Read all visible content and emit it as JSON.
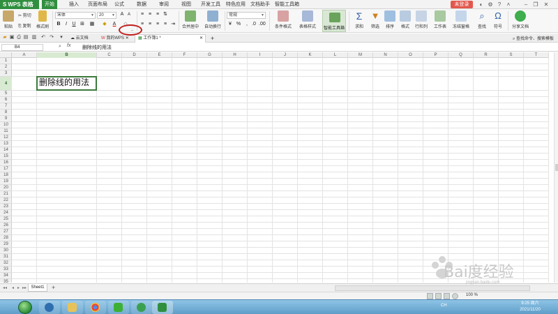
{
  "app": {
    "name": "WPS 表格"
  },
  "menu": {
    "tabs": [
      "开始",
      "插入",
      "页面布局",
      "公式",
      "数据",
      "审阅",
      "视图",
      "开发工具",
      "特色应用",
      "文档助手",
      "智能工具箱"
    ],
    "active": "开始",
    "login": "未登录"
  },
  "ribbon": {
    "paste": "粘贴",
    "cut": "剪切",
    "copy": "复制",
    "format_painter": "格式刷",
    "font_name": "宋体",
    "font_size": "20",
    "merge_center": "合并居中",
    "wrap_text": "自动换行",
    "number_format": "常规",
    "conditional_format": "条件格式",
    "table_style": "表格样式",
    "smart_toolbox": "智能工具箱",
    "sum": "求和",
    "filter": "筛选",
    "sort": "排序",
    "format": "格式",
    "rows_cols": "行和列",
    "worksheet": "工作表",
    "freeze": "冻结窗格",
    "find": "查找",
    "symbol": "符号",
    "share": "分享文档"
  },
  "doc_tabs": {
    "cloud": "云文档",
    "my_wps": "我的WPS",
    "workbook": "工作簿1 *",
    "hint": "查找命令、搜索模板"
  },
  "formula_bar": {
    "cell_ref": "B4",
    "fx": "fx",
    "value": "删除线的用法"
  },
  "grid": {
    "columns": [
      "A",
      "B",
      "C",
      "D",
      "E",
      "F",
      "G",
      "H",
      "I",
      "J",
      "K",
      "L",
      "M",
      "N",
      "O",
      "P",
      "Q",
      "R",
      "S",
      "T"
    ],
    "selected_col": "B",
    "selected_row": 4,
    "row_count": 35,
    "active_cell_text": "删除线的用法"
  },
  "sheets": {
    "tabs": [
      "Sheet1"
    ],
    "add": "+"
  },
  "status": {
    "zoom": "100 %"
  },
  "taskbar": {
    "lang": "CH",
    "time": "9:25 周六",
    "date": "2021/11/20"
  },
  "watermark": {
    "text": "Bai度经验",
    "url": "jingyan.baidu.com"
  },
  "colors": {
    "accent": "#2f8f3e",
    "login": "#e2574c",
    "annotation": "#c01e1e"
  }
}
